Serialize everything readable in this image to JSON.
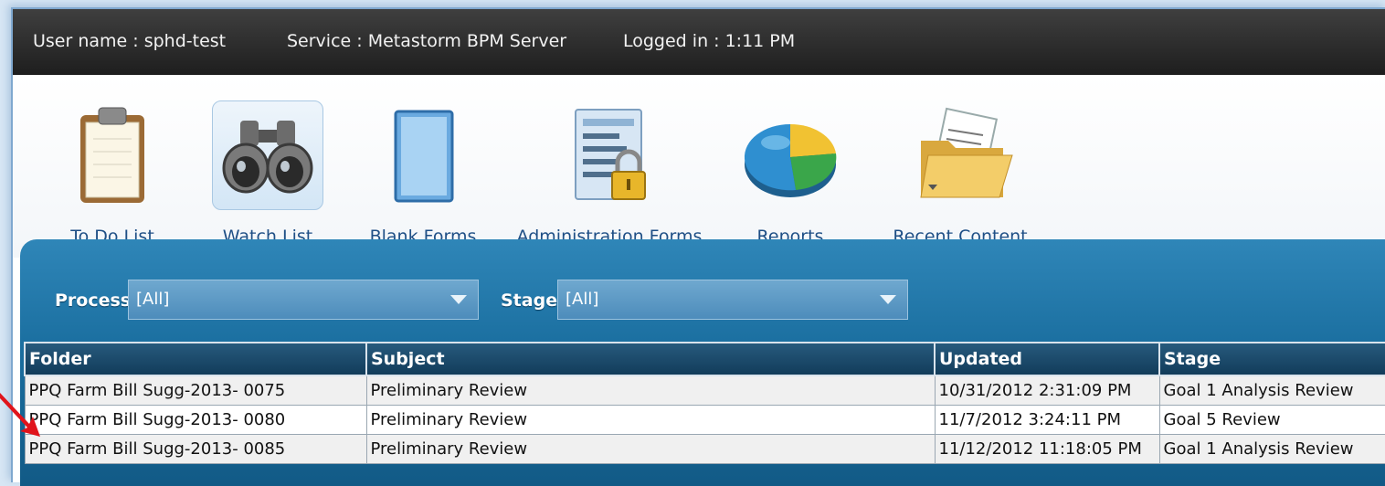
{
  "status_bar": {
    "user": "User name : sphd-test",
    "service": "Service : Metastorm BPM Server",
    "logged_in": "Logged in : 1:11 PM"
  },
  "toolbar": {
    "items": [
      {
        "label": "To Do List",
        "icon": "clipboard-icon"
      },
      {
        "label": "Watch List",
        "icon": "binoculars-icon",
        "selected": true
      },
      {
        "label": "Blank Forms",
        "icon": "blank-form-icon"
      },
      {
        "label": "Administration Forms",
        "icon": "locked-form-icon"
      },
      {
        "label": "Reports",
        "icon": "pie-chart-icon"
      },
      {
        "label": "Recent Content",
        "icon": "folder-icon"
      }
    ]
  },
  "filters": {
    "process_label": "Process",
    "process_value": "[All]",
    "stage_label": "Stage",
    "stage_value": "[All]"
  },
  "table": {
    "columns": [
      "Folder",
      "Subject",
      "Updated",
      "Stage"
    ],
    "rows": [
      {
        "folder": "PPQ Farm Bill Sugg-2013- 0075",
        "subject": "Preliminary Review",
        "updated": "10/31/2012 2:31:09 PM",
        "stage": "Goal 1 Analysis Review"
      },
      {
        "folder": "PPQ Farm Bill Sugg-2013- 0080",
        "subject": "Preliminary Review",
        "updated": "11/7/2012 3:24:11 PM",
        "stage": "Goal 5 Review"
      },
      {
        "folder": "PPQ Farm Bill Sugg-2013- 0085",
        "subject": "Preliminary Review",
        "updated": "11/12/2012 11:18:05 PM",
        "stage": "Goal 1 Analysis Review"
      }
    ]
  },
  "colors": {
    "header_bar": "#262626",
    "accent_blue": "#1a6e9f",
    "pointer_red": "#e0141b"
  }
}
